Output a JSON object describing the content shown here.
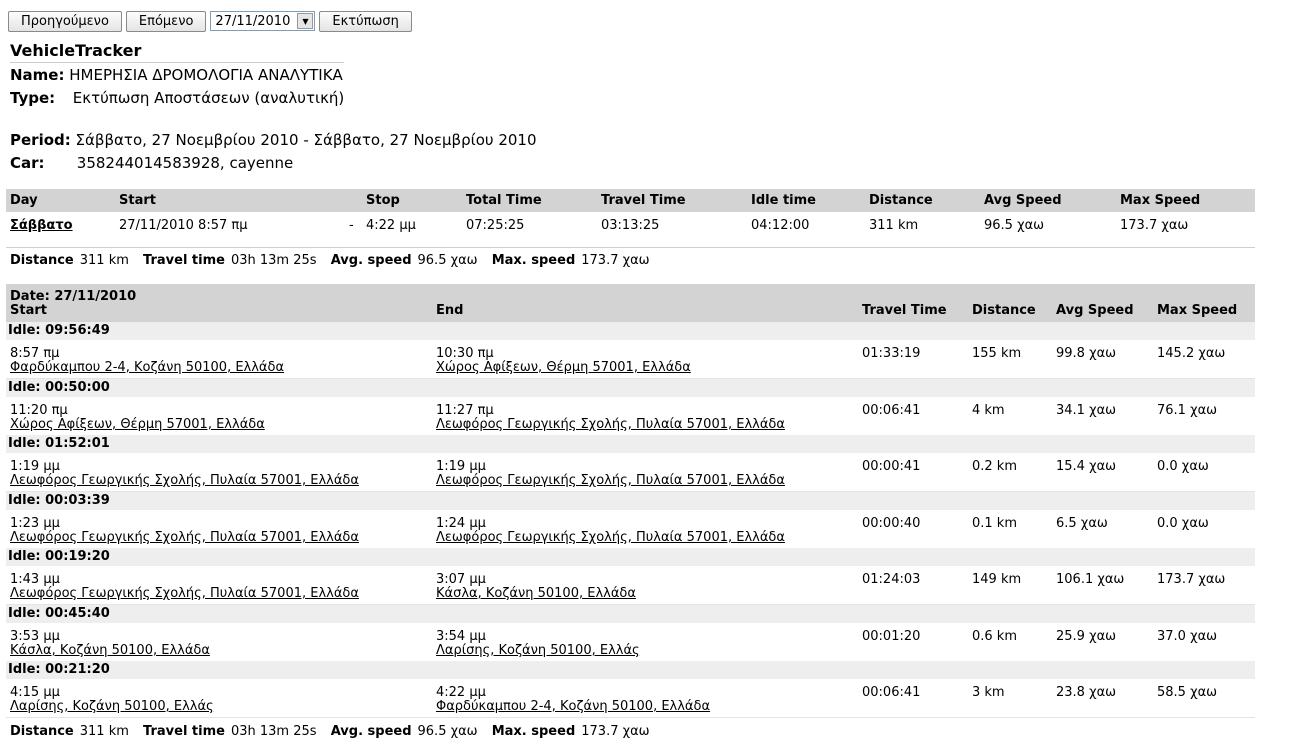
{
  "toolbar": {
    "prev": "Προηγούμενο",
    "next": "Επόμενο",
    "date": "27/11/2010",
    "print": "Εκτύπωση"
  },
  "app": "VehicleTracker",
  "meta": {
    "name_label": "Name:",
    "name": "ΗΜΕΡΗΣΙΑ ΔΡΟΜΟΛΟΓΙΑ ΑΝΑΛΥΤΙΚΑ",
    "type_label": "Type:",
    "type": "Εκτύπωση Αποστάσεων (αναλυτική)",
    "period_label": "Period:",
    "period": "Σάββατο, 27 Νοεμβρίου 2010 - Σάββατο, 27 Νοεμβρίου 2010",
    "car_label": "Car:",
    "car": "358244014583928, cayenne"
  },
  "day_table": {
    "headers": [
      "Day",
      "Start",
      "Stop",
      "Total Time",
      "Travel Time",
      "Idle time",
      "Distance",
      "Avg Speed",
      "Max Speed"
    ],
    "row": {
      "day": "Σάββατο",
      "start": "27/11/2010 8:57 πμ",
      "dash": "-",
      "stop": "4:22 μμ",
      "total": "07:25:25",
      "travel": "03:13:25",
      "idle": "04:12:00",
      "distance": "311 km",
      "avg": "96.5 χαω",
      "max": "173.7 χαω"
    }
  },
  "summary": {
    "distance_label": "Distance",
    "distance": "311 km",
    "travel_label": "Travel time",
    "travel": "03h 13m 25s",
    "avg_label": "Avg. speed",
    "avg": "96.5 χαω",
    "max_label": "Max. speed",
    "max": "173.7 χαω"
  },
  "detail": {
    "date_label": "Date: 27/11/2010",
    "headers": [
      "Start",
      "End",
      "Travel Time",
      "Distance",
      "Avg Speed",
      "Max Speed"
    ],
    "trips": [
      {
        "idle": "Idle: 09:56:49",
        "st": "8:57 πμ",
        "sa": "Φαρδύκαμπου 2-4, Κοζάνη 50100, Ελλάδα",
        "et": "10:30 πμ",
        "ea": "Χώρος Αφίξεων, Θέρμη 57001, Ελλάδα",
        "tt": "01:33:19",
        "d": "155 km",
        "av": "99.8 χαω",
        "mx": "145.2 χαω"
      },
      {
        "idle": "Idle: 00:50:00",
        "st": "11:20 πμ",
        "sa": "Χώρος Αφίξεων, Θέρμη 57001, Ελλάδα",
        "et": "11:27 πμ",
        "ea": "Λεωφόρος Γεωργικής Σχολής, Πυλαία 57001, Ελλάδα",
        "tt": "00:06:41",
        "d": "4 km",
        "av": "34.1 χαω",
        "mx": "76.1 χαω"
      },
      {
        "idle": "Idle: 01:52:01",
        "st": "1:19 μμ",
        "sa": "Λεωφόρος Γεωργικής Σχολής, Πυλαία 57001, Ελλάδα",
        "et": "1:19 μμ",
        "ea": "Λεωφόρος Γεωργικής Σχολής, Πυλαία 57001, Ελλάδα",
        "tt": "00:00:41",
        "d": "0.2 km",
        "av": "15.4 χαω",
        "mx": "0.0 χαω"
      },
      {
        "idle": "Idle: 00:03:39",
        "st": "1:23 μμ",
        "sa": "Λεωφόρος Γεωργικής Σχολής, Πυλαία 57001, Ελλάδα",
        "et": "1:24 μμ",
        "ea": "Λεωφόρος Γεωργικής Σχολής, Πυλαία 57001, Ελλάδα",
        "tt": "00:00:40",
        "d": "0.1 km",
        "av": "6.5 χαω",
        "mx": "0.0 χαω"
      },
      {
        "idle": "Idle: 00:19:20",
        "st": "1:43 μμ",
        "sa": "Λεωφόρος Γεωργικής Σχολής, Πυλαία 57001, Ελλάδα",
        "et": "3:07 μμ",
        "ea": "Κάσλα, Κοζάνη 50100, Ελλάδα",
        "tt": "01:24:03",
        "d": "149 km",
        "av": "106.1 χαω",
        "mx": "173.7 χαω"
      },
      {
        "idle": "Idle: 00:45:40",
        "st": "3:53 μμ",
        "sa": "Κάσλα, Κοζάνη 50100, Ελλάδα",
        "et": "3:54 μμ",
        "ea": "Λαρίσης, Κοζάνη 50100, Ελλάς",
        "tt": "00:01:20",
        "d": "0.6 km",
        "av": "25.9 χαω",
        "mx": "37.0 χαω"
      },
      {
        "idle": "Idle: 00:21:20",
        "st": "4:15 μμ",
        "sa": "Λαρίσης, Κοζάνη 50100, Ελλάς",
        "et": "4:22 μμ",
        "ea": "Φαρδύκαμπου 2-4, Κοζάνη 50100, Ελλάδα",
        "tt": "00:06:41",
        "d": "3 km",
        "av": "23.8 χαω",
        "mx": "58.5 χαω"
      }
    ]
  }
}
